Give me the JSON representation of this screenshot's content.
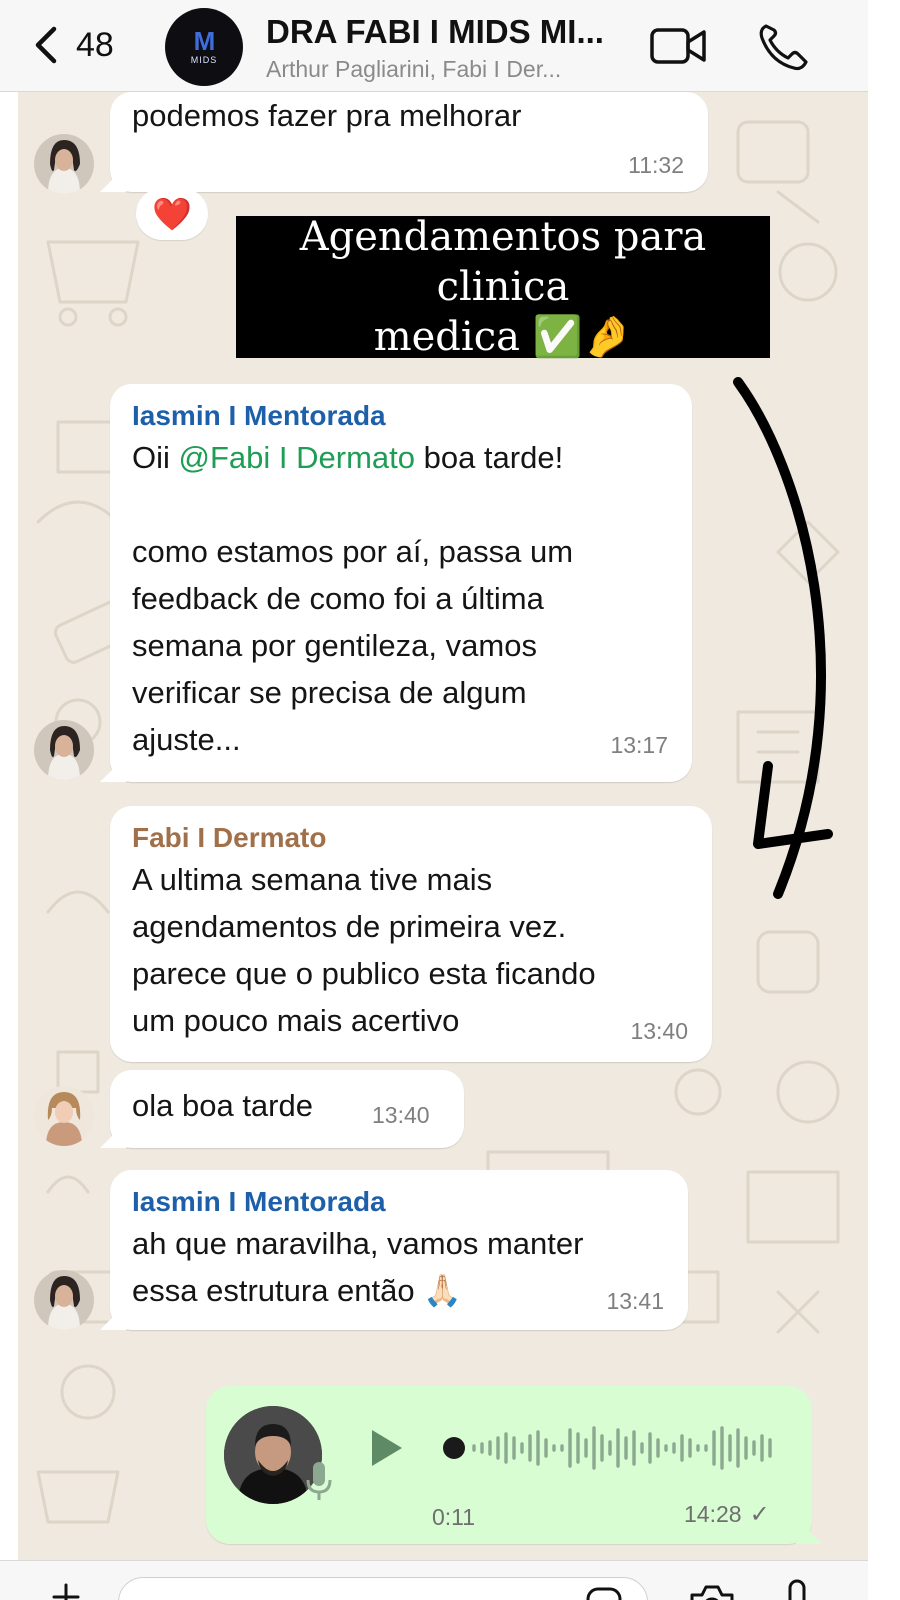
{
  "header": {
    "back_count": "48",
    "title": "DRA FABI I MIDS MI...",
    "subtitle": "Arthur Pagliarini, Fabi I Der...",
    "avatar_logo": "MIDS",
    "icons": {
      "back": "chevron-left-icon",
      "video": "video-call-icon",
      "phone": "voice-call-icon"
    }
  },
  "caption": {
    "line1": "Agendamentos para clinica",
    "line2": "medica ✅🤌"
  },
  "messages": [
    {
      "sender": "",
      "text": "podemos fazer pra melhorar",
      "time": "11:32"
    },
    {
      "sender": "Iasmin I Mentorada",
      "text_prefix": "Oii ",
      "mention": "@Fabi I Dermato",
      "text_suffix": " boa tarde!",
      "body": "como estamos por aí, passa um\nfeedback de como foi a última\nsemana por gentileza, vamos\nverificar se precisa de algum\najuste...",
      "time": "13:17"
    },
    {
      "sender": "Fabi I Dermato",
      "text": "A ultima semana tive mais\nagendamentos de primeira vez.\nparece que o publico esta ficando\num pouco mais acertivo",
      "time": "13:40"
    },
    {
      "sender": "",
      "text": "ola boa tarde",
      "time": "13:40"
    },
    {
      "sender": "Iasmin I Mentorada",
      "text": "ah que maravilha, vamos manter\nessa estrutura então 🙏🏻",
      "time": "13:41"
    }
  ],
  "reaction": "❤️",
  "voice_note": {
    "duration": "0:11",
    "time": "14:28",
    "status": "✓"
  },
  "colors": {
    "chat_bg": "#efe9df",
    "outgoing_bubble": "#d9fdd3",
    "sender_iasmin": "#1d5fa8",
    "sender_fabi": "#a0704a",
    "mention": "#1f9d55"
  }
}
